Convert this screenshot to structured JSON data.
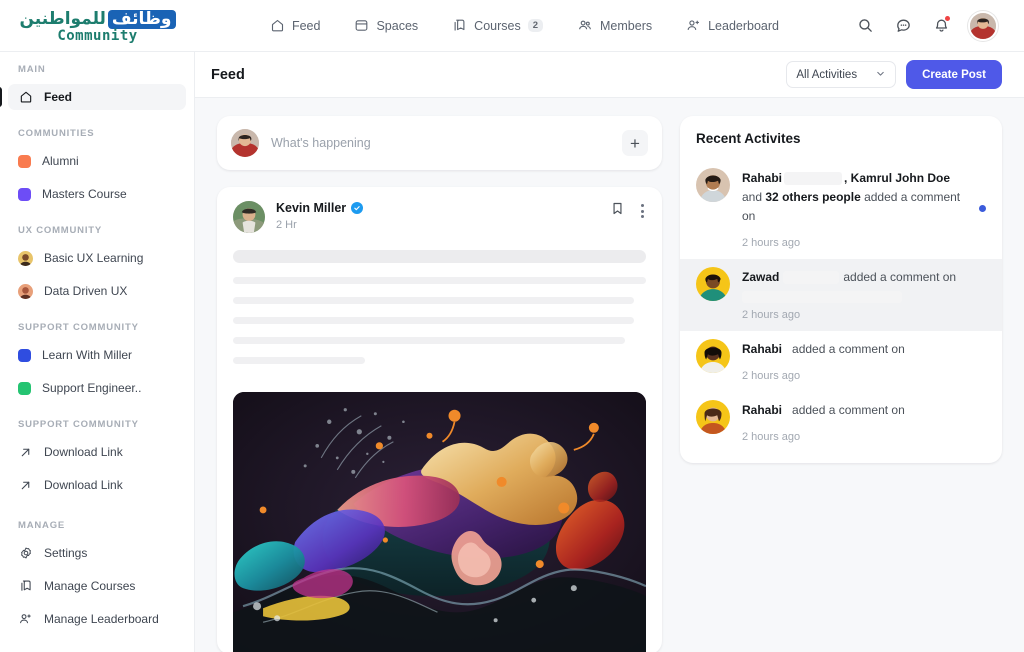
{
  "brand": {
    "arabic_prefix": "للمواطنين",
    "arabic_highlight": "وظائف",
    "subtitle": "Community"
  },
  "topnav": {
    "items": [
      {
        "label": "Feed",
        "icon": "home-icon",
        "badge": ""
      },
      {
        "label": "Spaces",
        "icon": "spaces-icon",
        "badge": ""
      },
      {
        "label": "Courses",
        "icon": "courses-icon",
        "badge": "2"
      },
      {
        "label": "Members",
        "icon": "members-icon",
        "badge": ""
      },
      {
        "label": "Leaderboard",
        "icon": "leaderboard-icon",
        "badge": ""
      }
    ],
    "actions": [
      {
        "icon": "search-icon"
      },
      {
        "icon": "chat-icon"
      },
      {
        "icon": "bell-icon"
      }
    ]
  },
  "sidebar": {
    "groups": [
      {
        "label": "MAIN",
        "items": [
          {
            "label": "Feed",
            "type": "icon",
            "icon": "home-icon",
            "active": true
          }
        ]
      },
      {
        "label": "COMMUNITIES",
        "items": [
          {
            "label": "Alumni",
            "type": "swatch",
            "color": "#f97b4f"
          },
          {
            "label": "Masters Course",
            "type": "swatch",
            "color": "#6d4df6"
          }
        ]
      },
      {
        "label": "UX COMMUNITY",
        "items": [
          {
            "label": "Basic UX Learning",
            "type": "avatar",
            "color": "#e8c46a"
          },
          {
            "label": "Data Driven UX",
            "type": "avatar",
            "color": "#e8a07a"
          }
        ]
      },
      {
        "label": "SUPPORT COMMUNITY",
        "items": [
          {
            "label": "Learn With Miller",
            "type": "swatch",
            "color": "#2f4de0"
          },
          {
            "label": "Support Engineer..",
            "type": "swatch",
            "color": "#25c472"
          }
        ]
      },
      {
        "label": "SUPPORT COMMUNITY",
        "items": [
          {
            "label": "Download Link",
            "type": "icon",
            "icon": "arrow-up-right-icon"
          },
          {
            "label": "Download Link",
            "type": "icon",
            "icon": "arrow-up-right-icon"
          }
        ]
      },
      {
        "label": "MANAGE",
        "items": [
          {
            "label": "Settings",
            "type": "icon",
            "icon": "gear-icon"
          },
          {
            "label": "Manage Courses",
            "type": "icon",
            "icon": "courses-icon"
          },
          {
            "label": "Manage Leaderboard",
            "type": "icon",
            "icon": "leaderboard-icon"
          }
        ]
      }
    ]
  },
  "page": {
    "title": "Feed",
    "filter_label": "All Activities",
    "create_post_label": "Create Post"
  },
  "composer": {
    "placeholder": "What's happening",
    "add_label": "+"
  },
  "post": {
    "author": "Kevin Miller",
    "verified": true,
    "time": "2 Hr",
    "bookmark_icon": "bookmark-icon",
    "more_icon": "more-vertical-icon",
    "body_redacted": true,
    "image_alt": "abstract colorful paint splash"
  },
  "recent_activities": {
    "title": "Recent Activites",
    "items": [
      {
        "name": "Rahabi",
        "text_mid": ", Kamrul John Doe",
        "text_and": " and ",
        "count": "32",
        "text_others": "others people",
        "action": " added a comment on",
        "time": "2 hours ago",
        "unread": true,
        "highlight": false,
        "avatar_color": "#d8c3b0",
        "redact_after_name": true,
        "multiline": true
      },
      {
        "name": "Zawad",
        "action": "added a comment on",
        "time": "2 hours ago",
        "unread": false,
        "highlight": true,
        "avatar_color": "#f5c518",
        "redact_after_name": true,
        "multiline": false
      },
      {
        "name": "Rahabi",
        "action": "added a comment on",
        "time": "2 hours ago",
        "unread": false,
        "highlight": false,
        "avatar_color": "#f5c518",
        "redact_after_name": false,
        "multiline": false
      },
      {
        "name": "Rahabi",
        "action": "added a comment on",
        "time": "2 hours ago",
        "unread": false,
        "highlight": false,
        "avatar_color": "#f5c518",
        "redact_after_name": false,
        "multiline": false
      }
    ]
  },
  "colors": {
    "accent": "#4f59e8",
    "unread_dot": "#3b5bdb",
    "notification_dot": "#ef4444",
    "verified": "#1d9bf0",
    "page_bg": "#f7f8fa"
  }
}
